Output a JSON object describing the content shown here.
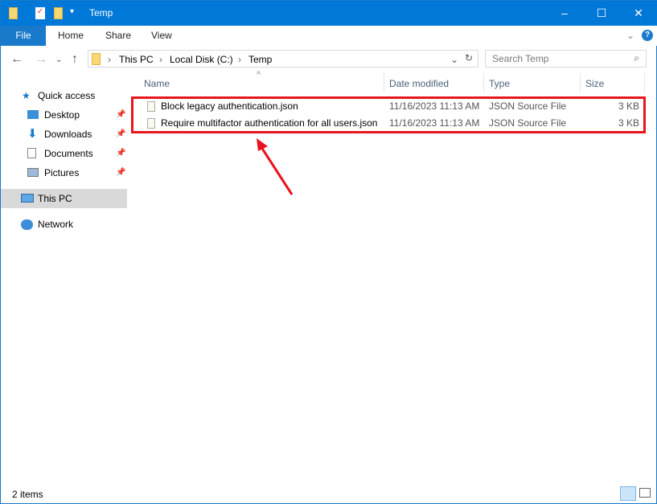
{
  "window": {
    "title": "Temp",
    "minimize": "–",
    "maximize": "☐",
    "close": "✕"
  },
  "ribbon": {
    "tabs": [
      "File",
      "Home",
      "Share",
      "View"
    ]
  },
  "address": {
    "crumbs": [
      "This PC",
      "Local Disk (C:)",
      "Temp"
    ]
  },
  "search": {
    "placeholder": "Search Temp"
  },
  "sidebar": {
    "items": [
      {
        "label": "Quick access"
      },
      {
        "label": "Desktop"
      },
      {
        "label": "Downloads"
      },
      {
        "label": "Documents"
      },
      {
        "label": "Pictures"
      },
      {
        "label": "This PC"
      },
      {
        "label": "Network"
      }
    ]
  },
  "columns": [
    "Name",
    "Date modified",
    "Type",
    "Size"
  ],
  "files": [
    {
      "name": "Block legacy authentication.json",
      "date": "11/16/2023 11:13 AM",
      "type": "JSON Source File",
      "size": "3 KB"
    },
    {
      "name": "Require multifactor authentication for all users.json",
      "date": "11/16/2023 11:13 AM",
      "type": "JSON Source File",
      "size": "3 KB"
    }
  ],
  "status": {
    "count": "2 items"
  },
  "colors": {
    "accent": "#0078d7",
    "highlight": "#e8141e"
  }
}
